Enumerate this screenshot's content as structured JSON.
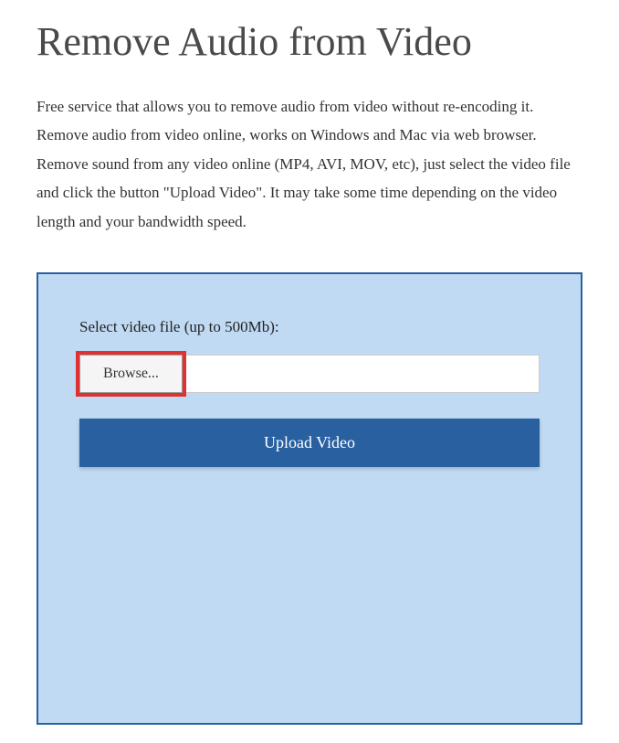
{
  "header": {
    "title": "Remove Audio from Video"
  },
  "main": {
    "description": "Free service that allows you to remove audio from video without re-encoding it. Remove audio from video online, works on Windows and Mac via web browser. Remove sound from any video online (MP4, AVI, MOV, etc), just select the video file and click the button \"Upload Video\". It may take some time depending on the video length and your bandwidth speed."
  },
  "form": {
    "select_label": "Select video file (up to 500Mb):",
    "browse_label": "Browse...",
    "file_path": "",
    "upload_label": "Upload Video"
  }
}
